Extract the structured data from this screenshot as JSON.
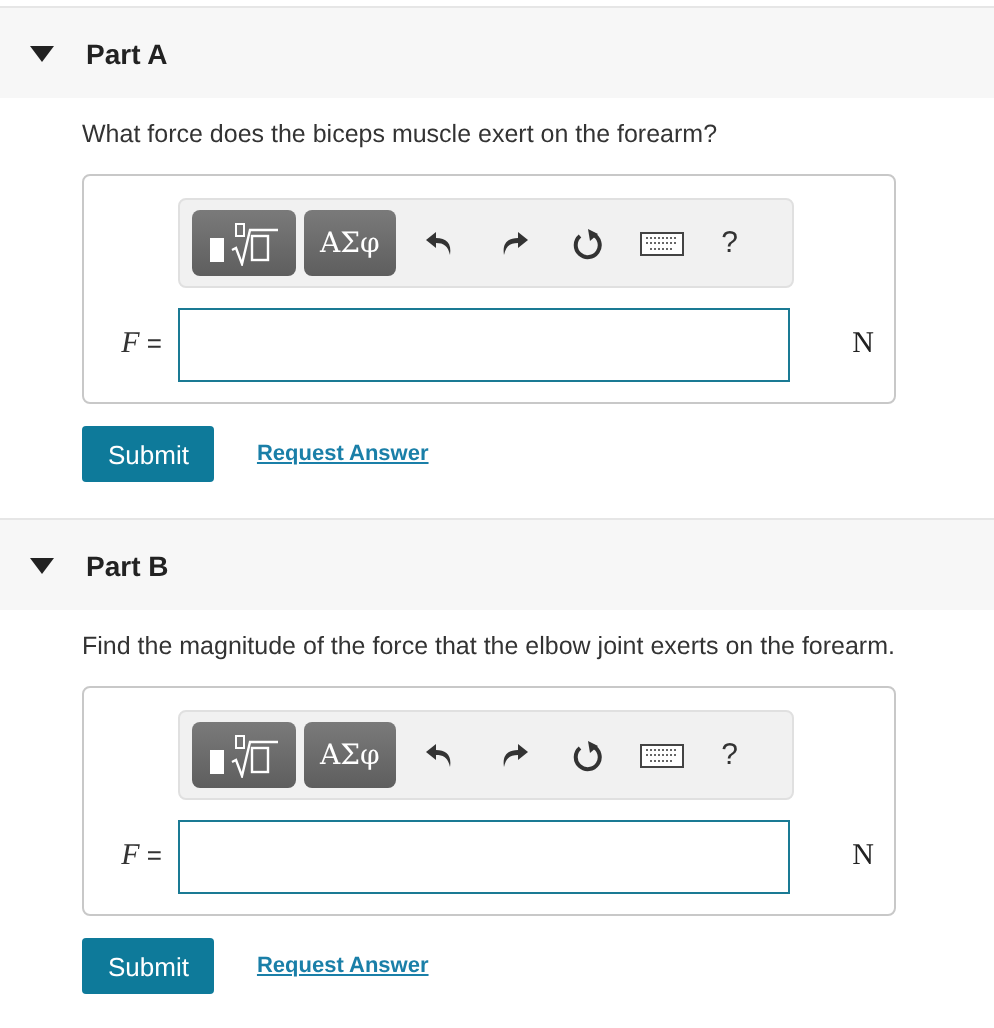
{
  "parts": [
    {
      "title": "Part A",
      "expanded": true,
      "question": "What force does the biceps muscle exert on the forearm?",
      "symbols_label": "ΑΣφ",
      "help_label": "?",
      "variable": "F",
      "equals": "=",
      "unit": "N",
      "submit": "Submit",
      "request": "Request Answer"
    },
    {
      "title": "Part B",
      "expanded": true,
      "question": "Find the magnitude of the force that the elbow joint exerts on the forearm.",
      "symbols_label": "ΑΣφ",
      "help_label": "?",
      "variable": "F",
      "equals": "=",
      "unit": "N",
      "submit": "Submit",
      "request": "Request Answer"
    }
  ]
}
